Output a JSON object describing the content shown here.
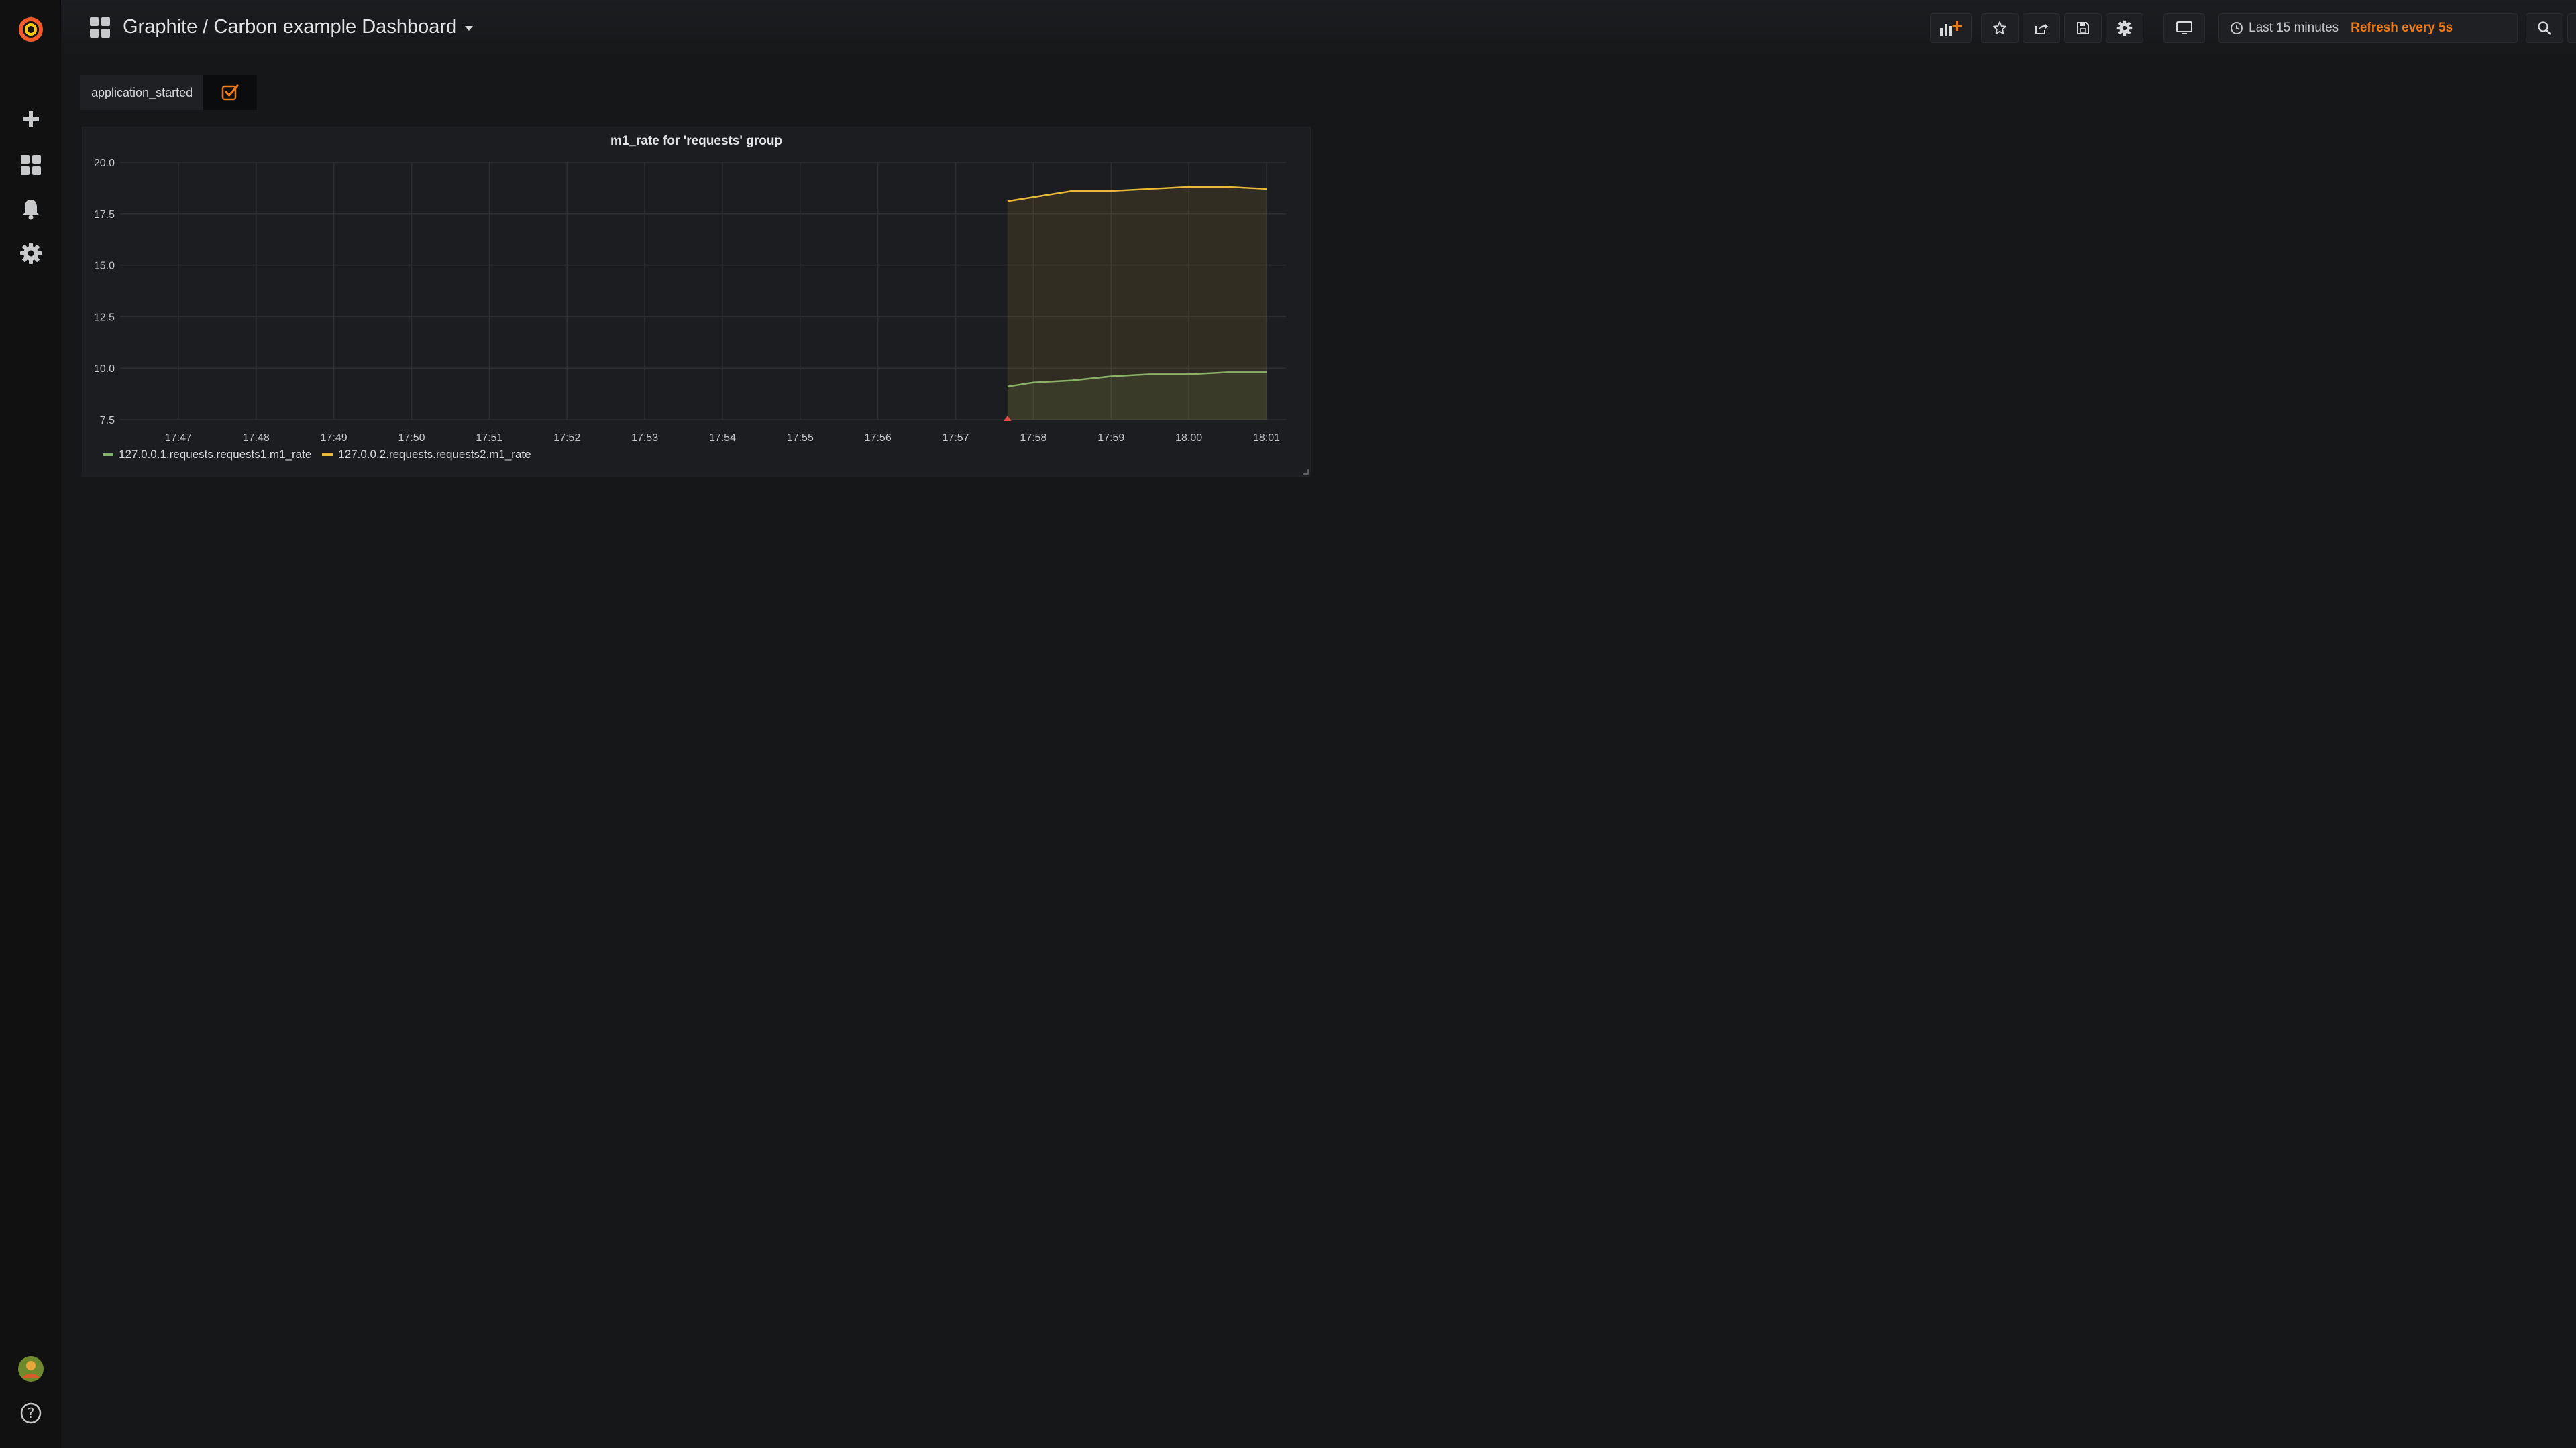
{
  "navbar": {
    "dashboard_title": "Graphite / Carbon example Dashboard",
    "time_range": "Last 15 minutes",
    "refresh": "Refresh every 5s",
    "buttons": [
      {
        "name": "add-panel-button",
        "icon": "add-panel-icon"
      },
      {
        "name": "star-button",
        "icon": "star-icon"
      },
      {
        "name": "share-button",
        "icon": "share-icon"
      },
      {
        "name": "save-button",
        "icon": "save-icon"
      },
      {
        "name": "settings-button",
        "icon": "gear-icon"
      },
      {
        "name": "tv-mode-button",
        "icon": "monitor-icon"
      },
      {
        "name": "zoom-out-button",
        "icon": "search-icon"
      },
      {
        "name": "refresh-button",
        "icon": "refresh-icon"
      }
    ]
  },
  "sidebar": {
    "items": [
      {
        "name": "create",
        "icon": "plus-icon"
      },
      {
        "name": "dashboards",
        "icon": "apps-icon"
      },
      {
        "name": "alerting",
        "icon": "bell-icon"
      },
      {
        "name": "configuration",
        "icon": "gear-icon"
      },
      {
        "name": "profile",
        "icon": "avatar-icon"
      },
      {
        "name": "help",
        "icon": "question-icon"
      }
    ]
  },
  "annotations": {
    "label": "application_started",
    "enabled": true
  },
  "colors": {
    "accent": "#eb7b18",
    "series1": "#7eb26d",
    "series2": "#eab839",
    "annotation": "#e24d42"
  },
  "panel": {
    "title": "m1_rate for 'requests' group"
  },
  "chart_data": {
    "type": "line",
    "title": "m1_rate for 'requests' group",
    "xlabel": "",
    "ylabel": "",
    "ylim": [
      7.5,
      20.0
    ],
    "yticks": [
      "20.0",
      "17.5",
      "15.0",
      "12.5",
      "10.0",
      "7.5"
    ],
    "xlim": [
      "17:46:15",
      "18:01:15"
    ],
    "xticks": [
      "17:47",
      "17:48",
      "17:49",
      "17:50",
      "17:51",
      "17:52",
      "17:53",
      "17:54",
      "17:55",
      "17:56",
      "17:57",
      "17:58",
      "17:59",
      "18:00",
      "18:01"
    ],
    "grid": true,
    "legend": "bottom-left",
    "annotation_time": "17:57:40",
    "series": [
      {
        "name": "127.0.0.1.requests.requests1.m1_rate",
        "color": "#7eb26d",
        "x": [
          "17:57:40",
          "17:58:00",
          "17:58:30",
          "17:59:00",
          "17:59:30",
          "18:00:00",
          "18:00:30",
          "18:01:00"
        ],
        "values": [
          9.1,
          9.3,
          9.4,
          9.6,
          9.7,
          9.7,
          9.8,
          9.8
        ]
      },
      {
        "name": "127.0.0.2.requests.requests2.m1_rate",
        "color": "#eab839",
        "x": [
          "17:57:40",
          "17:58:00",
          "17:58:30",
          "17:59:00",
          "17:59:30",
          "18:00:00",
          "18:00:30",
          "18:01:00"
        ],
        "values": [
          18.1,
          18.3,
          18.6,
          18.6,
          18.7,
          18.8,
          18.8,
          18.7
        ]
      }
    ]
  }
}
